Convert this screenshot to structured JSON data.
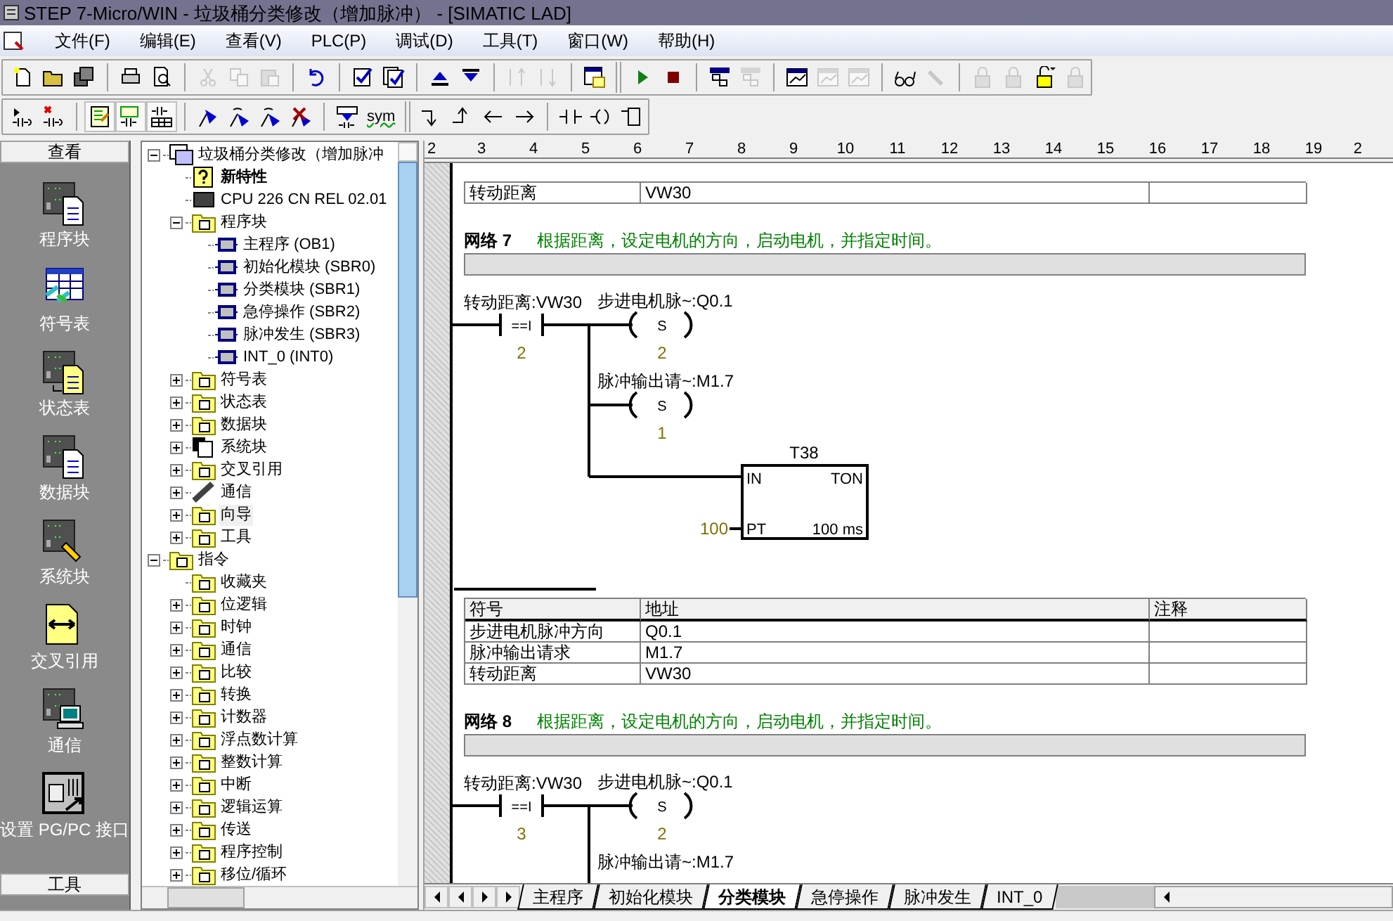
{
  "window": {
    "title": "STEP 7-Micro/WIN - 垃圾桶分类修改（增加脉冲） - [SIMATIC LAD]"
  },
  "menu": [
    {
      "label": "文件(F)"
    },
    {
      "label": "编辑(E)"
    },
    {
      "label": "查看(V)"
    },
    {
      "label": "PLC(P)"
    },
    {
      "label": "调试(D)"
    },
    {
      "label": "工具(T)"
    },
    {
      "label": "窗口(W)"
    },
    {
      "label": "帮助(H)"
    }
  ],
  "toolbar_1": [
    {
      "kind": "new",
      "disabled": false
    },
    {
      "kind": "open",
      "disabled": false
    },
    {
      "kind": "save",
      "disabled": false
    },
    {
      "kind": "sep"
    },
    {
      "kind": "print",
      "disabled": false
    },
    {
      "kind": "preview",
      "disabled": false
    },
    {
      "kind": "sep"
    },
    {
      "kind": "cut",
      "disabled": true
    },
    {
      "kind": "copy",
      "disabled": true
    },
    {
      "kind": "paste",
      "disabled": true
    },
    {
      "kind": "sep"
    },
    {
      "kind": "undo",
      "disabled": false
    },
    {
      "kind": "sep"
    },
    {
      "kind": "check",
      "disabled": false
    },
    {
      "kind": "check_all",
      "disabled": false
    },
    {
      "kind": "sep"
    },
    {
      "kind": "upload",
      "disabled": false
    },
    {
      "kind": "download",
      "disabled": false
    },
    {
      "kind": "sep"
    },
    {
      "kind": "sort_up",
      "disabled": true
    },
    {
      "kind": "sort_down",
      "disabled": true
    },
    {
      "kind": "sep"
    },
    {
      "kind": "window",
      "disabled": false
    },
    {
      "kind": "grip"
    },
    {
      "kind": "run",
      "disabled": false
    },
    {
      "kind": "stop",
      "disabled": false
    },
    {
      "kind": "sep"
    },
    {
      "kind": "program_status",
      "disabled": false
    },
    {
      "kind": "program_status",
      "disabled": true
    },
    {
      "kind": "sep"
    },
    {
      "kind": "chart",
      "disabled": false
    },
    {
      "kind": "chart",
      "disabled": true
    },
    {
      "kind": "chart",
      "disabled": true
    },
    {
      "kind": "sep"
    },
    {
      "kind": "glasses",
      "disabled": false
    },
    {
      "kind": "force",
      "disabled": true
    },
    {
      "kind": "sep"
    },
    {
      "kind": "lock",
      "disabled": true
    },
    {
      "kind": "lock",
      "disabled": true
    },
    {
      "kind": "unlock",
      "disabled": false
    },
    {
      "kind": "lock",
      "disabled": true
    }
  ],
  "toolbar_2": [
    {
      "kind": "insert_network",
      "disabled": false
    },
    {
      "kind": "delete_network",
      "disabled": false
    },
    {
      "kind": "sep"
    },
    {
      "kind": "view_notes",
      "pressed": true
    },
    {
      "kind": "view_comments",
      "pressed": true
    },
    {
      "kind": "view_table",
      "pressed": true
    },
    {
      "kind": "sep"
    },
    {
      "kind": "flag",
      "disabled": false
    },
    {
      "kind": "flag_next",
      "disabled": false
    },
    {
      "kind": "flag_prev",
      "disabled": false
    },
    {
      "kind": "flag_remove",
      "disabled": false
    },
    {
      "kind": "sep"
    },
    {
      "kind": "apply",
      "disabled": false
    },
    {
      "kind": "symbol",
      "label": "sym",
      "disabled": false
    },
    {
      "kind": "grip"
    },
    {
      "kind": "line_down",
      "disabled": false
    },
    {
      "kind": "line_up",
      "disabled": false
    },
    {
      "kind": "line_left",
      "disabled": false
    },
    {
      "kind": "line_right",
      "disabled": false
    },
    {
      "kind": "sep"
    },
    {
      "kind": "contact",
      "disabled": false
    },
    {
      "kind": "coil",
      "disabled": false
    },
    {
      "kind": "box",
      "disabled": false
    }
  ],
  "navigation_bar": {
    "header": "查看",
    "items": [
      {
        "label": "程序块",
        "kind": "program"
      },
      {
        "label": "符号表",
        "kind": "symbols"
      },
      {
        "label": "状态表",
        "kind": "status"
      },
      {
        "label": "数据块",
        "kind": "data"
      },
      {
        "label": "系统块",
        "kind": "system"
      },
      {
        "label": "交叉引用",
        "kind": "xref"
      },
      {
        "label": "通信",
        "kind": "comm"
      },
      {
        "label": "设置 PG/PC 接口",
        "kind": "pgpc"
      }
    ],
    "footer": "工具"
  },
  "tree": [
    {
      "label": "垃圾桶分类修改（增加脉冲",
      "kind": "project",
      "expanded": true,
      "children": [
        {
          "label": "新特性",
          "kind": "info",
          "bold": true
        },
        {
          "label": "CPU 226 CN REL 02.01",
          "kind": "cpu"
        },
        {
          "label": "程序块",
          "kind": "folder",
          "expanded": true,
          "children": [
            {
              "label": "主程序 (OB1)",
              "kind": "block"
            },
            {
              "label": "初始化模块 (SBR0)",
              "kind": "block"
            },
            {
              "label": "分类模块 (SBR1)",
              "kind": "block"
            },
            {
              "label": "急停操作 (SBR2)",
              "kind": "block"
            },
            {
              "label": "脉冲发生 (SBR3)",
              "kind": "block"
            },
            {
              "label": "INT_0 (INT0)",
              "kind": "block"
            }
          ]
        },
        {
          "label": "符号表",
          "kind": "folder",
          "expanded": false
        },
        {
          "label": "状态表",
          "kind": "folder",
          "expanded": false
        },
        {
          "label": "数据块",
          "kind": "folder",
          "expanded": false
        },
        {
          "label": "系统块",
          "kind": "pages",
          "expanded": false
        },
        {
          "label": "交叉引用",
          "kind": "folder",
          "expanded": false
        },
        {
          "label": "通信",
          "kind": "cable",
          "expanded": false
        },
        {
          "label": "向导",
          "kind": "folder",
          "expanded": false,
          "selected": true
        },
        {
          "label": "工具",
          "kind": "folder",
          "expanded": false
        }
      ]
    },
    {
      "label": "指令",
      "kind": "folder",
      "expanded": true,
      "children": [
        {
          "label": "收藏夹",
          "kind": "folder"
        },
        {
          "label": "位逻辑",
          "kind": "folder",
          "expanded": false
        },
        {
          "label": "时钟",
          "kind": "folder",
          "expanded": false
        },
        {
          "label": "通信",
          "kind": "folder",
          "expanded": false
        },
        {
          "label": "比较",
          "kind": "folder",
          "expanded": false
        },
        {
          "label": "转换",
          "kind": "folder",
          "expanded": false
        },
        {
          "label": "计数器",
          "kind": "folder",
          "expanded": false
        },
        {
          "label": "浮点数计算",
          "kind": "folder",
          "expanded": false
        },
        {
          "label": "整数计算",
          "kind": "folder",
          "expanded": false
        },
        {
          "label": "中断",
          "kind": "folder",
          "expanded": false
        },
        {
          "label": "逻辑运算",
          "kind": "folder",
          "expanded": false
        },
        {
          "label": "传送",
          "kind": "folder",
          "expanded": false
        },
        {
          "label": "程序控制",
          "kind": "folder",
          "expanded": false
        },
        {
          "label": "移位/循环",
          "kind": "folder",
          "expanded": false
        }
      ]
    }
  ],
  "ruler": [
    "2",
    "3",
    "4",
    "5",
    "6",
    "7",
    "8",
    "9",
    "10",
    "11",
    "12",
    "13",
    "14",
    "15",
    "16",
    "17",
    "18",
    "19",
    "2"
  ],
  "editor": [
    {
      "kind": "symbol_table",
      "rows": [
        [
          "转动距离",
          "VW30",
          ""
        ]
      ]
    },
    {
      "kind": "network",
      "title": "网络 7",
      "comment": "根据距离，设定电机的方向，启动电机，并指定时间。",
      "elements": [
        {
          "kind": "contact",
          "label": "转动距离:VW30",
          "operator": "==I",
          "value": "2"
        },
        {
          "kind": "coil",
          "label": "步进电机脉~:Q0.1",
          "operator": "S",
          "value": "2"
        },
        {
          "kind": "coil",
          "label": "脉冲输出请~:M1.7",
          "operator": "S",
          "value": "1"
        },
        {
          "kind": "timer",
          "name": "T38",
          "type": "TON",
          "input": "IN",
          "preset_pin": "PT",
          "preset": "100",
          "resolution": "100 ms"
        }
      ]
    },
    {
      "kind": "title_field"
    },
    {
      "kind": "symbol_table",
      "columns": [
        "符号",
        "地址",
        "注释"
      ],
      "rows": [
        [
          "步进电机脉冲方向",
          "Q0.1",
          ""
        ],
        [
          "脉冲输出请求",
          "M1.7",
          ""
        ],
        [
          "转动距离",
          "VW30",
          ""
        ]
      ]
    },
    {
      "kind": "network",
      "title": "网络 8",
      "comment": "根据距离，设定电机的方向，启动电机，并指定时间。",
      "elements": [
        {
          "kind": "contact",
          "label": "转动距离:VW30",
          "operator": "==I",
          "value": "3"
        },
        {
          "kind": "coil",
          "label": "步进电机脉~:Q0.1",
          "operator": "S",
          "value": "2"
        },
        {
          "kind": "coil_label",
          "label": "脉冲输出请~:M1.7"
        }
      ]
    }
  ],
  "tabs": [
    {
      "label": "主程序",
      "selected": false
    },
    {
      "label": "初始化模块",
      "selected": false
    },
    {
      "label": "分类模块",
      "selected": true
    },
    {
      "label": "急停操作",
      "selected": false
    },
    {
      "label": "脉冲发生",
      "selected": false
    },
    {
      "label": "INT_0",
      "selected": false
    }
  ]
}
